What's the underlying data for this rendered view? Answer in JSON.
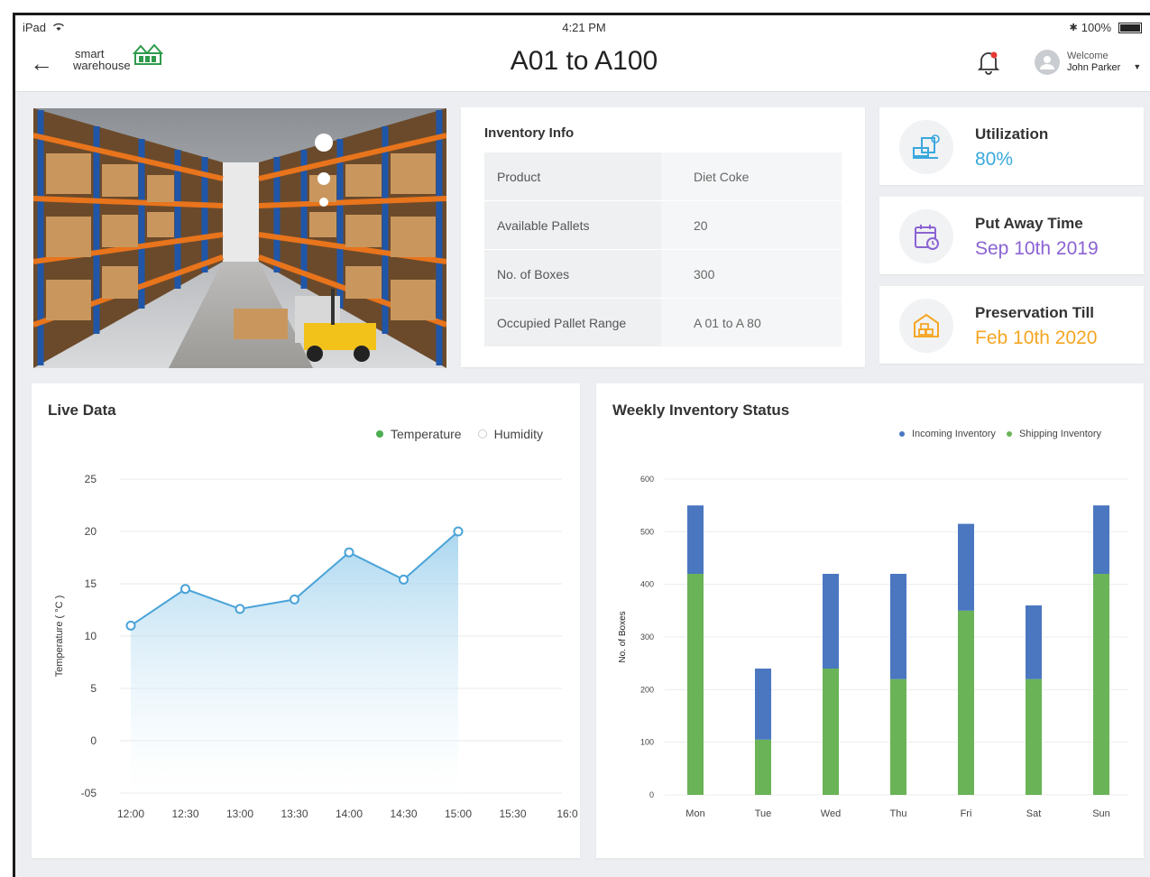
{
  "status_bar": {
    "device": "iPad",
    "time": "4:21 PM",
    "battery": "100%"
  },
  "header": {
    "logo_line1": "smart",
    "logo_line2": "warehouse",
    "title": "A01 to A100",
    "welcome": "Welcome",
    "user_name": "John Parker"
  },
  "inventory": {
    "title": "Inventory Info",
    "rows": [
      {
        "label": "Product",
        "value": "Diet Coke"
      },
      {
        "label": "Available Pallets",
        "value": "20"
      },
      {
        "label": "No. of Boxes",
        "value": "300"
      },
      {
        "label": "Occupied Pallet Range",
        "value": "A 01 to A 80"
      }
    ]
  },
  "stats": [
    {
      "label": "Utilization",
      "value": "80%",
      "color": "#3aa8dd",
      "icon": "desk-icon"
    },
    {
      "label": "Put Away Time",
      "value": "Sep 10th 2019",
      "color": "#8a63d2",
      "icon": "calendar-clock-icon"
    },
    {
      "label": "Preservation Till",
      "value": "Feb 10th 2020",
      "color": "#f5a623",
      "icon": "warehouse-icon"
    }
  ],
  "live": {
    "title": "Live Data",
    "legend": [
      {
        "name": "Temperature",
        "color": "#4caf50"
      },
      {
        "name": "Humidity",
        "color": "#ffffff"
      }
    ]
  },
  "weekly": {
    "title": "Weekly Inventory Status",
    "legend": [
      {
        "name": "Incoming Inventory",
        "color": "#4a77c0"
      },
      {
        "name": "Shipping Inventory",
        "color": "#6ab356"
      }
    ]
  },
  "chart_data": [
    {
      "type": "area",
      "title": "Live Data",
      "ylabel": "Temperature ( °C )",
      "ylim": [
        -5,
        25
      ],
      "yticks": [
        "25",
        "20",
        "15",
        "10",
        "5",
        "0",
        "-05"
      ],
      "ytick_values": [
        25,
        20,
        15,
        10,
        5,
        0,
        -5
      ],
      "categories": [
        "12:00",
        "12:30",
        "13:00",
        "13:30",
        "14:00",
        "14:30",
        "15:00",
        "15:30",
        "16:0"
      ],
      "series": [
        {
          "name": "Temperature",
          "values": [
            11,
            14.5,
            12.6,
            13.5,
            18,
            15.4,
            20
          ],
          "color": "#4aa3d8"
        }
      ]
    },
    {
      "type": "bar",
      "title": "Weekly Inventory Status",
      "ylabel": "No. of Boxes",
      "ylim": [
        0,
        600
      ],
      "yticks": [
        "600",
        "500",
        "400",
        "300",
        "200",
        "100",
        "0"
      ],
      "ytick_values": [
        600,
        500,
        400,
        300,
        200,
        100,
        0
      ],
      "categories": [
        "Mon",
        "Tue",
        "Wed",
        "Thu",
        "Fri",
        "Sat",
        "Sun"
      ],
      "stacked": true,
      "series": [
        {
          "name": "Shipping Inventory",
          "values": [
            420,
            105,
            240,
            220,
            350,
            220,
            420
          ],
          "color": "#6ab356"
        },
        {
          "name": "Incoming Inventory",
          "values": [
            130,
            135,
            180,
            200,
            165,
            140,
            130
          ],
          "color": "#4a77c0"
        }
      ]
    }
  ]
}
